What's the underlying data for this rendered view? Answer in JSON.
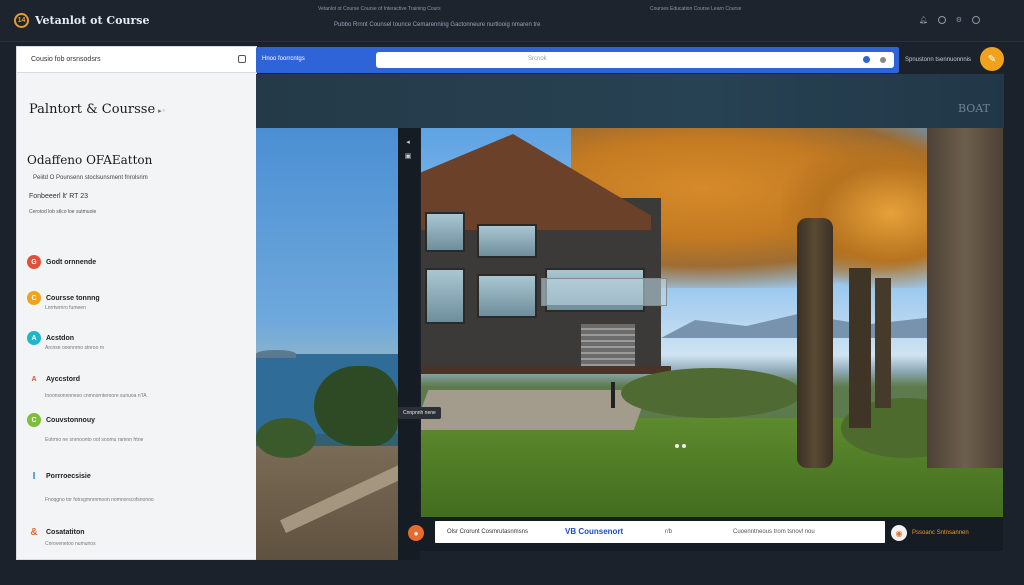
{
  "topbar": {
    "brand": "Vetanlot ot Course",
    "center_line": "Vetanlot ot Course Course of Interactive Training Cours",
    "right_line": "Courses Education Course Learn Course",
    "sub_line": "Pubbo Rrnnt Counsel tounce Cemarenning Gactonneure nurtlooig nmaren tre",
    "icons": [
      "bell-icon",
      "help-icon",
      "user-icon"
    ]
  },
  "left_panel": {
    "search_text": "Cousio fob orsnsodsrs",
    "title": "Palntort & Coursse",
    "subhead": "Odaffeno OFAEatton",
    "line1": "Peiitd O Pounsenn stoclsunsment fnrolsrim",
    "line2": "Fonbeeerl lt’ RT 23",
    "line3": "Cerotod lob stlco loe sutmuole",
    "items": [
      {
        "label": "Godt ornnende",
        "sub": "",
        "color": "#e0503a",
        "glyph": "G"
      },
      {
        "label": "Coursse tonnng",
        "sub": "Lnrrtwrnro fumeen",
        "color": "#f0a21c",
        "glyph": "C"
      },
      {
        "label": "Acstdon",
        "sub": "Arcnse ooonnrno stnroo rn",
        "color": "#1fb6c9",
        "glyph": "A"
      },
      {
        "label": "Ayccstord",
        "sub": "Inoonsonnnneso cnmnornteroore sunuoa nTA",
        "color": "#e0503a",
        "glyph": "A"
      },
      {
        "label": "Couvstonnouy",
        "sub": "Eotrmo ne snrnoonto oot soomu ramnn frtne",
        "color": "#7cbf3a",
        "glyph": "C"
      },
      {
        "label": "Porrroecsisie",
        "sub": "Fnoqgno tor fotrsgmnrnmoon nomnorscofsnonoo",
        "color": "#1f8fd9",
        "glyph": "I"
      },
      {
        "label": "Cosatatiton",
        "sub": "Cnrovenetoo numunos",
        "color": "#e86a2c",
        "glyph": "&"
      }
    ]
  },
  "urlbar": {
    "tab": "Hnoo foorrcntgs",
    "field": "Srcnok"
  },
  "topright_label": "Spnustonn tsennuonnnis",
  "band_label": "BOAT",
  "scene": {
    "tooltip": "Cnnpnnh nene"
  },
  "bottombar": {
    "f1": "Olsr Crorunt Cosmrutasnmsns",
    "f2": "VB Counsenort",
    "f3": "r/b",
    "f4": "Cuoenntneous trom tsnovl nou",
    "right_text": "Pssoanc Sntnsannen"
  },
  "colors": {
    "accent_orange": "#f0a21c",
    "url_blue": "#2f64d8",
    "background": "#1b222c"
  }
}
